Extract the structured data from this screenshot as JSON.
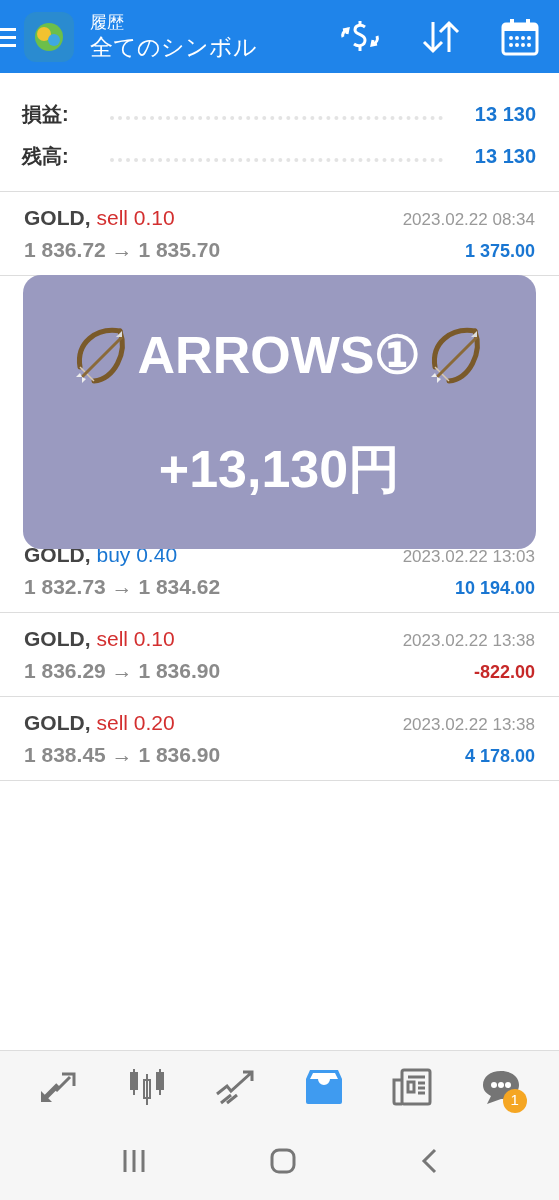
{
  "header": {
    "title": "履歴",
    "subtitle": "全てのシンボル"
  },
  "summary": [
    {
      "label": "損益:",
      "value": "13 130"
    },
    {
      "label": "残高:",
      "value": "13 130"
    }
  ],
  "deals_before": [
    {
      "symbol": "GOLD,",
      "side": "sell 0.10",
      "color": "#d32f2f",
      "open": "1 836.72",
      "close": "1 835.70",
      "time": "2023.02.22 08:34",
      "profit": "1 375.00",
      "loss": false
    }
  ],
  "overlay": {
    "title": "ARROWS①",
    "amount": "+13,130円"
  },
  "deals_after": [
    {
      "symbol": "GOLD,",
      "side": "buy 0.40",
      "color": "#1976d2",
      "open": "1 832.73",
      "close": "1 834.62",
      "time": "2023.02.22 13:03",
      "profit": "10 194.00",
      "loss": false
    },
    {
      "symbol": "GOLD,",
      "side": "sell 0.10",
      "color": "#d32f2f",
      "open": "1 836.29",
      "close": "1 836.90",
      "time": "2023.02.22 13:38",
      "profit": "-822.00",
      "loss": true
    },
    {
      "symbol": "GOLD,",
      "side": "sell 0.20",
      "color": "#d32f2f",
      "open": "1 838.45",
      "close": "1 836.90",
      "time": "2023.02.22 13:38",
      "profit": "4 178.00",
      "loss": false
    }
  ],
  "arrow_char": "→",
  "bottom_nav": [
    {
      "kind": "trade",
      "selected": false
    },
    {
      "kind": "chart",
      "selected": false
    },
    {
      "kind": "trend",
      "selected": false
    },
    {
      "kind": "history",
      "selected": true
    },
    {
      "kind": "news",
      "selected": false
    },
    {
      "kind": "chat",
      "selected": false,
      "badge": "1"
    }
  ]
}
